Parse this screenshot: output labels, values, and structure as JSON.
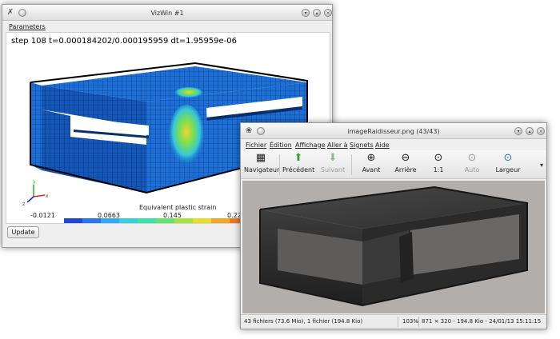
{
  "vizwin": {
    "title": "VizWin #1",
    "menu": [
      "Parameters"
    ],
    "step_text": "step 108  t=0.000184202/0.000195959  dt=1.95959e-06",
    "legend": {
      "title": "Equivalent plastic strain",
      "ticks": [
        "-0.0121",
        "0.0663",
        "0.145",
        "0.223"
      ],
      "colors": [
        "#1f46d8",
        "#2a76ee",
        "#2fa7f2",
        "#36d0e0",
        "#3ee0a8",
        "#62e46a",
        "#a6e33c",
        "#e6de2a",
        "#f4a82a",
        "#f1761f"
      ]
    },
    "update_label": "Update",
    "axes": {
      "x": "x",
      "y": "y",
      "z": "z"
    }
  },
  "imgwin": {
    "title": "imageRaidisseur.png (43/43)",
    "menu": [
      "Fichier",
      "Édition",
      "Affichage",
      "Aller à",
      "Signets",
      "Aide"
    ],
    "toolbar": {
      "navigator": "Navigateur",
      "previous": "Précédent",
      "next": "Suivant",
      "zoom_in": "Avant",
      "zoom_out": "Arrière",
      "actual_size": "1:1",
      "auto": "Auto",
      "fit_width": "Largeur"
    },
    "status": {
      "files": "43 fichiers (73.6 Mio), 1 fichier (194.8 Kio)",
      "zoom": "103%",
      "info": "871 × 320 - 194.8 Kio - 24/01/13 15:11:15"
    }
  }
}
